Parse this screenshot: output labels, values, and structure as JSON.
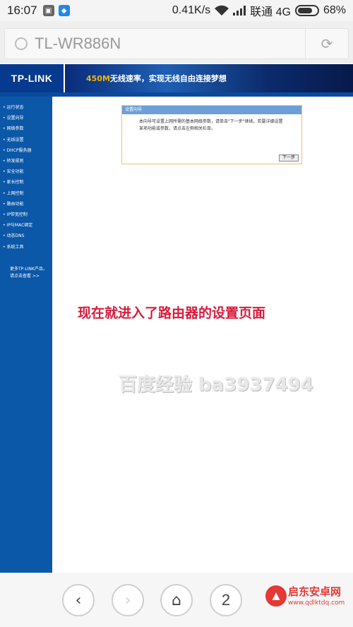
{
  "status_bar": {
    "time": "16:07",
    "network_speed": "0.41K/s",
    "carrier": "联通 4G",
    "battery": "68%"
  },
  "browser": {
    "url_title": "TL-WR886N"
  },
  "router": {
    "logo": "TP-LINK",
    "banner_highlight": "450M",
    "banner_text": "无线速率，实现无线自由连接梦想",
    "sidebar_items": [
      "运行状态",
      "设置向导",
      "网络参数",
      "无线设置",
      "DHCP服务器",
      "转发规则",
      "安全功能",
      "家长控制",
      "上网控制",
      "路由功能",
      "IP带宽控制",
      "IP与MAC绑定",
      "动态DNS",
      "系统工具"
    ],
    "sidebar_more_line1": "更多TP-LINK产品，",
    "sidebar_more_line2": "请点击查看 >>",
    "dialog": {
      "title": "设置向导",
      "body_line1": "本向导可设置上网所需的基本网络参数，请单击\"下一步\"继续。若要详细设置",
      "body_line2": "某项功能或参数，请点击左侧相关栏目。",
      "next_button": "下一步"
    }
  },
  "annotation": "现在就进入了路由器的设置页面",
  "watermark": "百度经验 ba3937494",
  "bottom_nav": {
    "back_icon": "‹",
    "forward_icon": "›",
    "home_icon": "⌂",
    "tab_count": "2"
  },
  "corner_logo": {
    "title": "启东安卓网",
    "url": "www.qdlktdq.com"
  },
  "colors": {
    "sidebar": "#0b57a8",
    "header": "#0e2e6e",
    "annotation": "#d81b3c"
  }
}
